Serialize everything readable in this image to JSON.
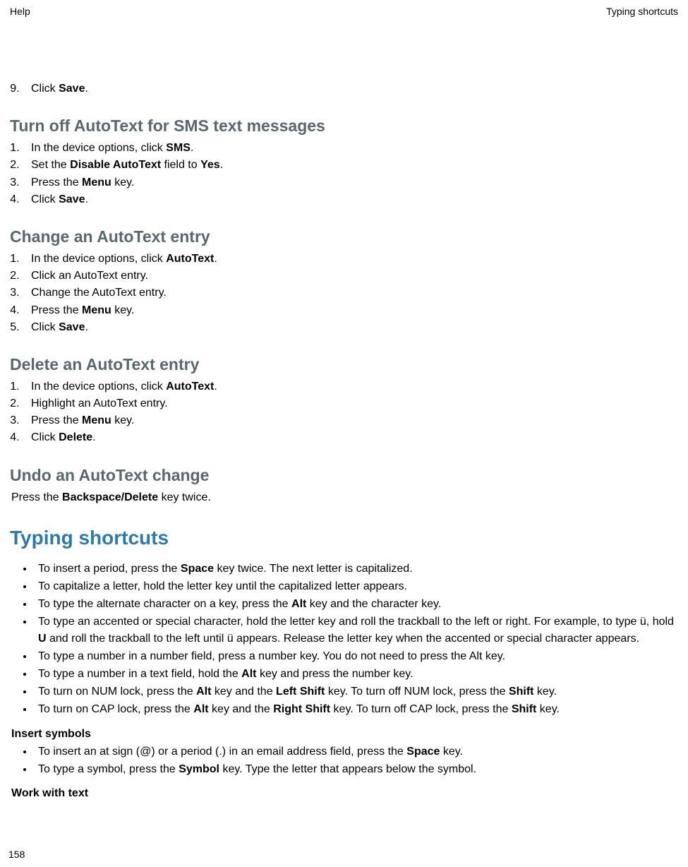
{
  "header": {
    "left": "Help",
    "right": "Typing shortcuts"
  },
  "step9": {
    "num": "9.",
    "text_prefix": "Click ",
    "text_bold": "Save",
    "text_suffix": "."
  },
  "section_turnoff": {
    "title": "Turn off AutoText for SMS text messages",
    "steps": [
      {
        "pre": "In the device options, click ",
        "b": "SMS",
        "post": "."
      },
      {
        "pre": "Set the ",
        "b": "Disable AutoText",
        "mid": " field to ",
        "b2": "Yes",
        "post": "."
      },
      {
        "pre": "Press the ",
        "b": "Menu",
        "post": " key."
      },
      {
        "pre": "Click ",
        "b": "Save",
        "post": "."
      }
    ]
  },
  "section_change": {
    "title": "Change an AutoText entry",
    "steps": [
      {
        "pre": "In the device options, click ",
        "b": "AutoText",
        "post": "."
      },
      {
        "pre": "Click an AutoText entry.",
        "b": "",
        "post": ""
      },
      {
        "pre": "Change the AutoText entry.",
        "b": "",
        "post": ""
      },
      {
        "pre": "Press the ",
        "b": "Menu",
        "post": " key."
      },
      {
        "pre": "Click ",
        "b": "Save",
        "post": "."
      }
    ]
  },
  "section_delete": {
    "title": "Delete an AutoText entry",
    "steps": [
      {
        "pre": "In the device options, click ",
        "b": "AutoText",
        "post": "."
      },
      {
        "pre": "Highlight an AutoText entry.",
        "b": "",
        "post": ""
      },
      {
        "pre": "Press the ",
        "b": "Menu",
        "post": " key."
      },
      {
        "pre": "Click ",
        "b": "Delete",
        "post": "."
      }
    ]
  },
  "section_undo": {
    "title": "Undo an AutoText change",
    "para_pre": "Press the ",
    "para_b": "Backspace/Delete",
    "para_post": " key twice."
  },
  "section_typing": {
    "title": "Typing shortcuts",
    "bullets": [
      {
        "pre": "To insert a period, press the ",
        "b": "Space",
        "post": " key twice. The next letter is capitalized."
      },
      {
        "pre": "To capitalize a letter, hold the letter key until the capitalized letter appears.",
        "b": "",
        "post": ""
      },
      {
        "pre": "To type the alternate character on a key, press the ",
        "b": "Alt",
        "post": " key and the character key."
      },
      {
        "pre": "To type an accented or special character, hold the letter key and roll the trackball to the left or right. For example, to type ü, hold ",
        "b": "U",
        "post": " and roll the trackball to the left until ü appears. Release the letter key when the accented or special character appears."
      },
      {
        "pre": "To type a number in a number field, press a number key. You do not need to press the Alt key.",
        "b": "",
        "post": ""
      },
      {
        "pre": "To type a number in a text field, hold the ",
        "b": "Alt",
        "post": " key and press the number key."
      },
      {
        "pre": "To turn on NUM lock, press the ",
        "b": "Alt",
        "mid": " key and the ",
        "b2": "Left Shift",
        "mid2": " key. To turn off NUM lock, press the ",
        "b3": "Shift",
        "post": " key."
      },
      {
        "pre": "To turn on CAP lock, press the ",
        "b": "Alt",
        "mid": " key and the ",
        "b2": "Right Shift",
        "mid2": " key. To turn off CAP lock, press the ",
        "b3": "Shift",
        "post": " key."
      }
    ]
  },
  "section_insert": {
    "title": "Insert symbols",
    "bullets": [
      {
        "pre": "To insert an at sign (@) or a period (.) in an email address field, press the ",
        "b": "Space",
        "post": " key."
      },
      {
        "pre": "To type a symbol, press the ",
        "b": "Symbol",
        "post": " key. Type the letter that appears below the symbol."
      }
    ]
  },
  "section_work": {
    "title": "Work with text"
  },
  "pagenum": "158"
}
